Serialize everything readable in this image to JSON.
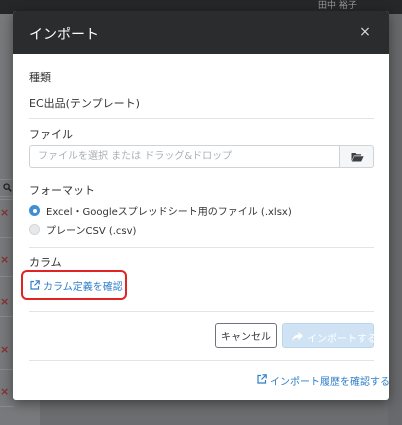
{
  "background": {
    "user_name": "田中 裕子"
  },
  "modal": {
    "title": "インポート",
    "close_icon": "×",
    "type_label": "種類",
    "type_value": "EC出品(テンプレート)",
    "file_label": "ファイル",
    "file_placeholder": "ファイルを選択 または ドラッグ&ドロップ",
    "file_button_icon": "folder-open-icon",
    "format_label": "フォーマット",
    "format_options": [
      {
        "label": "Excel・Googleスプレッドシート用のファイル (.xlsx)",
        "selected": true
      },
      {
        "label": "プレーンCSV (.csv)",
        "selected": false
      }
    ],
    "column_label": "カラム",
    "column_link": "カラム定義を確認",
    "cancel_button": "キャンセル",
    "import_button": "インポートする",
    "history_link": "インポート履歴を確認する"
  },
  "colors": {
    "header_bg": "#2b2c2e",
    "link": "#2f7fc8",
    "highlight": "#e02424",
    "radio_selected": "#3f8fd6",
    "import_button_disabled": "#cfe3f4"
  }
}
